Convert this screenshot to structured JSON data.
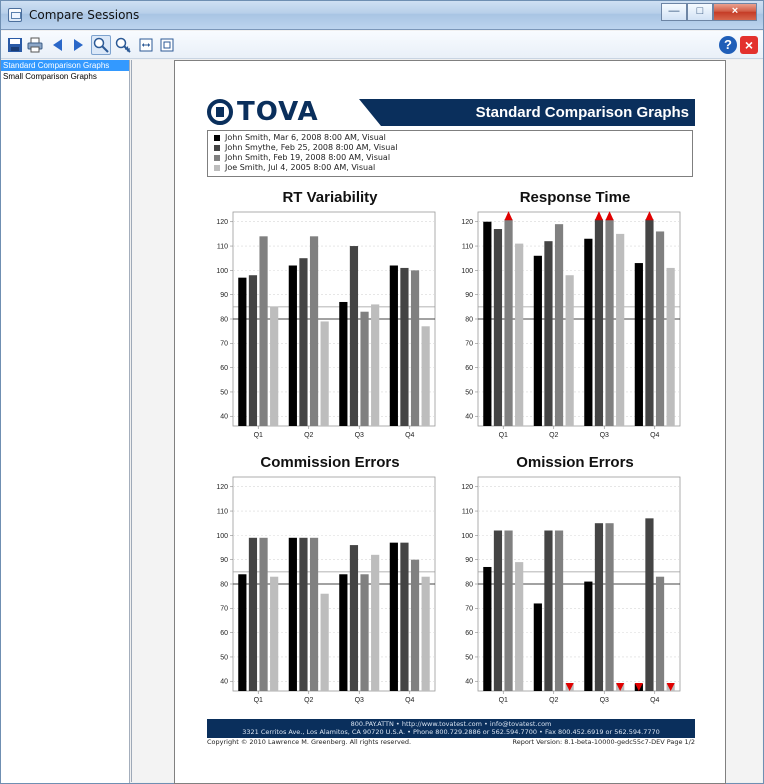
{
  "window": {
    "title": "Compare Sessions"
  },
  "toolbar": {
    "buttons": [
      {
        "name": "save-icon"
      },
      {
        "name": "print-icon"
      },
      {
        "name": "previous-page-icon"
      },
      {
        "name": "next-page-icon"
      },
      {
        "name": "zoom-fit-icon"
      },
      {
        "name": "zoom-in-icon"
      },
      {
        "name": "fit-width-icon"
      },
      {
        "name": "fit-page-icon"
      }
    ],
    "help_label": "?",
    "close_label": "×"
  },
  "sidebar": {
    "items": [
      {
        "label": "Standard Comparison Graphs",
        "selected": true
      },
      {
        "label": "Small Comparison Graphs",
        "selected": false
      }
    ]
  },
  "report": {
    "logo_text": "TOVA",
    "title": "Standard Comparison Graphs",
    "legend": [
      {
        "label": "John Smith, Mar 6, 2008 8:00 AM, Visual",
        "color": "#000000"
      },
      {
        "label": "John Smythe, Feb 25, 2008 8:00 AM, Visual",
        "color": "#444444"
      },
      {
        "label": "John Smith, Feb 19, 2008 8:00 AM, Visual",
        "color": "#808080"
      },
      {
        "label": "Joe Smith, Jul 4, 2005 8:00 AM, Visual",
        "color": "#bdbdbd"
      }
    ],
    "footer": {
      "line1": "800.PAY.ATTN • http://www.tovatest.com • info@tovatest.com",
      "line2": "3321 Cerritos Ave., Los Alamitos, CA 90720 U.S.A. • Phone 800.729.2886 or 562.594.7700 • Fax 800.452.6919 or 562.594.7770",
      "copyright": "Copyright © 2010 Lawrence M. Greenberg. All rights reserved.",
      "version": "Report Version: 8.1-beta-10000-gedc55c7-DEV   Page 1/2"
    }
  },
  "chart_data": [
    {
      "type": "bar",
      "title": "RT Variability",
      "categories": [
        "Q1",
        "Q2",
        "Q3",
        "Q4"
      ],
      "ylim": [
        36,
        124
      ],
      "yticks": [
        40,
        50,
        60,
        70,
        80,
        90,
        100,
        110,
        120
      ],
      "reference_lines": [
        80,
        85
      ],
      "series": [
        {
          "values": [
            97,
            102,
            87,
            102
          ],
          "color": "#000000"
        },
        {
          "values": [
            98,
            105,
            110,
            101
          ],
          "color": "#444444"
        },
        {
          "values": [
            114,
            114,
            83,
            100
          ],
          "color": "#808080"
        },
        {
          "values": [
            85,
            79,
            86,
            77
          ],
          "color": "#bdbdbd"
        }
      ],
      "overflow_markers": []
    },
    {
      "type": "bar",
      "title": "Response Time",
      "categories": [
        "Q1",
        "Q2",
        "Q3",
        "Q4"
      ],
      "ylim": [
        36,
        124
      ],
      "yticks": [
        40,
        50,
        60,
        70,
        80,
        90,
        100,
        110,
        120
      ],
      "reference_lines": [
        80,
        85
      ],
      "series": [
        {
          "values": [
            120,
            106,
            113,
            103
          ],
          "color": "#000000"
        },
        {
          "values": [
            117,
            112,
            121,
            121
          ],
          "color": "#444444"
        },
        {
          "values": [
            121,
            119,
            121,
            116
          ],
          "color": "#808080"
        },
        {
          "values": [
            111,
            98,
            115,
            101
          ],
          "color": "#bdbdbd"
        }
      ],
      "overflow_markers": [
        {
          "category": 0,
          "series": 2,
          "direction": "up"
        },
        {
          "category": 2,
          "series": 1,
          "direction": "up"
        },
        {
          "category": 2,
          "series": 2,
          "direction": "up"
        },
        {
          "category": 3,
          "series": 1,
          "direction": "up"
        }
      ]
    },
    {
      "type": "bar",
      "title": "Commission Errors",
      "categories": [
        "Q1",
        "Q2",
        "Q3",
        "Q4"
      ],
      "ylim": [
        36,
        124
      ],
      "yticks": [
        40,
        50,
        60,
        70,
        80,
        90,
        100,
        110,
        120
      ],
      "reference_lines": [
        80,
        85
      ],
      "series": [
        {
          "values": [
            84,
            99,
            84,
            97
          ],
          "color": "#000000"
        },
        {
          "values": [
            99,
            99,
            96,
            97
          ],
          "color": "#444444"
        },
        {
          "values": [
            99,
            99,
            84,
            90
          ],
          "color": "#808080"
        },
        {
          "values": [
            83,
            76,
            92,
            83
          ],
          "color": "#bdbdbd"
        }
      ],
      "overflow_markers": []
    },
    {
      "type": "bar",
      "title": "Omission Errors",
      "categories": [
        "Q1",
        "Q2",
        "Q3",
        "Q4"
      ],
      "ylim": [
        36,
        124
      ],
      "yticks": [
        40,
        50,
        60,
        70,
        80,
        90,
        100,
        110,
        120
      ],
      "reference_lines": [
        80,
        85
      ],
      "series": [
        {
          "values": [
            87,
            72,
            81,
            39
          ],
          "color": "#000000"
        },
        {
          "values": [
            102,
            102,
            105,
            107
          ],
          "color": "#444444"
        },
        {
          "values": [
            102,
            102,
            105,
            83
          ],
          "color": "#808080"
        },
        {
          "values": [
            89,
            39,
            39,
            39
          ],
          "color": "#bdbdbd"
        }
      ],
      "overflow_markers": [
        {
          "category": 1,
          "series": 3,
          "direction": "down"
        },
        {
          "category": 2,
          "series": 3,
          "direction": "down"
        },
        {
          "category": 3,
          "series": 0,
          "direction": "down"
        },
        {
          "category": 3,
          "series": 3,
          "direction": "down"
        }
      ]
    }
  ]
}
